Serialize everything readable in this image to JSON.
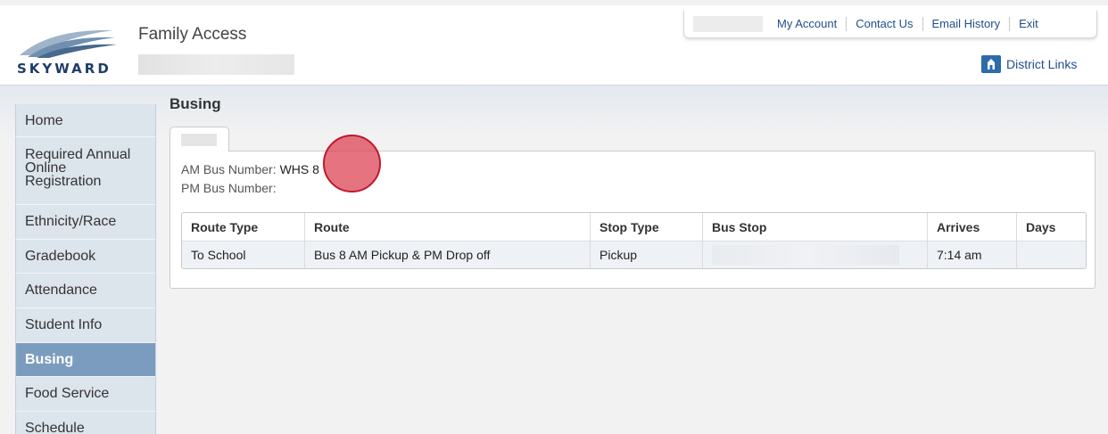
{
  "header": {
    "app_title": "Family Access",
    "logo_text": "SKYWARD",
    "nav": [
      "My Account",
      "Contact Us",
      "Email History",
      "Exit"
    ],
    "district_links": "District Links"
  },
  "sidebar": {
    "items": [
      {
        "label": "Home"
      },
      {
        "label": "Required Annual Online Registration"
      },
      {
        "label": "Ethnicity/Race"
      },
      {
        "label": "Gradebook"
      },
      {
        "label": "Attendance"
      },
      {
        "label": "Student Info"
      },
      {
        "label": "Busing",
        "active": true
      },
      {
        "label": "Food Service"
      },
      {
        "label": "Schedule"
      }
    ]
  },
  "main": {
    "title": "Busing",
    "am_bus": {
      "label": "AM Bus Number:",
      "value": "WHS 8"
    },
    "pm_bus": {
      "label": "PM Bus Number:",
      "value": ""
    },
    "table": {
      "headers": [
        "Route Type",
        "Route",
        "Stop Type",
        "Bus Stop",
        "Arrives",
        "Days"
      ],
      "rows": [
        [
          "To School",
          "Bus 8 AM Pickup & PM Drop off",
          "Pickup",
          "",
          "7:14 am",
          ""
        ]
      ]
    }
  },
  "colors": {
    "accent": "#1f4f8c",
    "active_nav": "#7b9cbe",
    "marker": "#c0182e"
  }
}
